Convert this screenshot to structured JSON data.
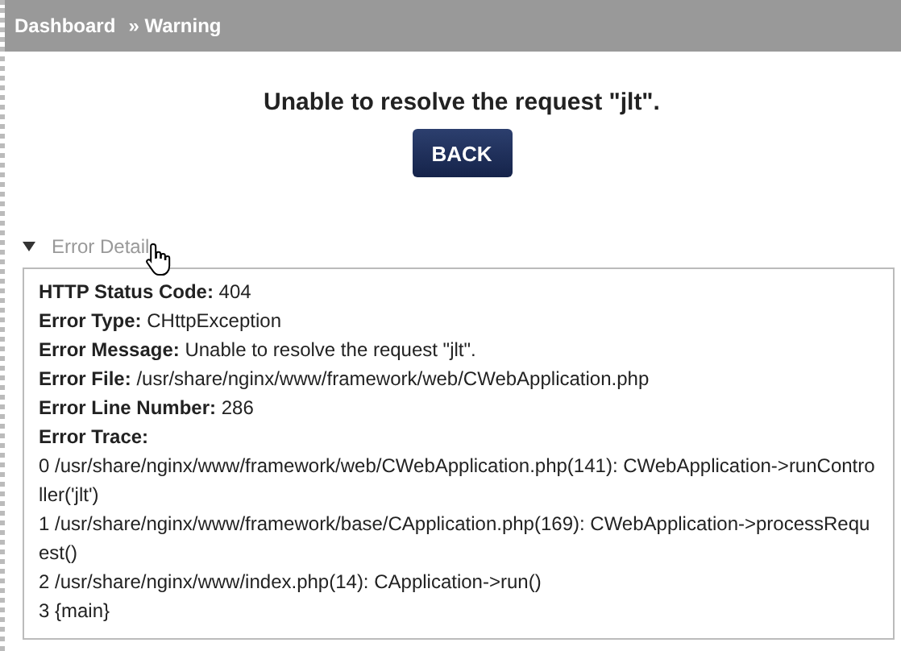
{
  "breadcrumb": [
    "Dashboard",
    "» Warning"
  ],
  "message": "Unable to resolve the request \"jlt\".",
  "back_button": "BACK",
  "error_detail": {
    "label": "Error Detail",
    "expanded": true,
    "fields": [
      {
        "label": "HTTP Status Code:",
        "value": "404"
      },
      {
        "label": "Error Type:",
        "value": "CHttpException"
      },
      {
        "label": "Error Message:",
        "value": "Unable to resolve the request \"jlt\"."
      },
      {
        "label": "Error File:",
        "value": "/usr/share/nginx/www/framework/web/CWebApplication.php"
      },
      {
        "label": "Error Line Number:",
        "value": "286"
      },
      {
        "label": "Error Trace:"
      }
    ],
    "trace": [
      "0 /usr/share/nginx/www/framework/web/CWebApplication.php(141): CWebApplication->runController('jlt')",
      "1 /usr/share/nginx/www/framework/base/CApplication.php(169): CWebApplication->processRequest()",
      "2 /usr/share/nginx/www/index.php(14): CApplication->run()",
      "3 {main}"
    ]
  }
}
